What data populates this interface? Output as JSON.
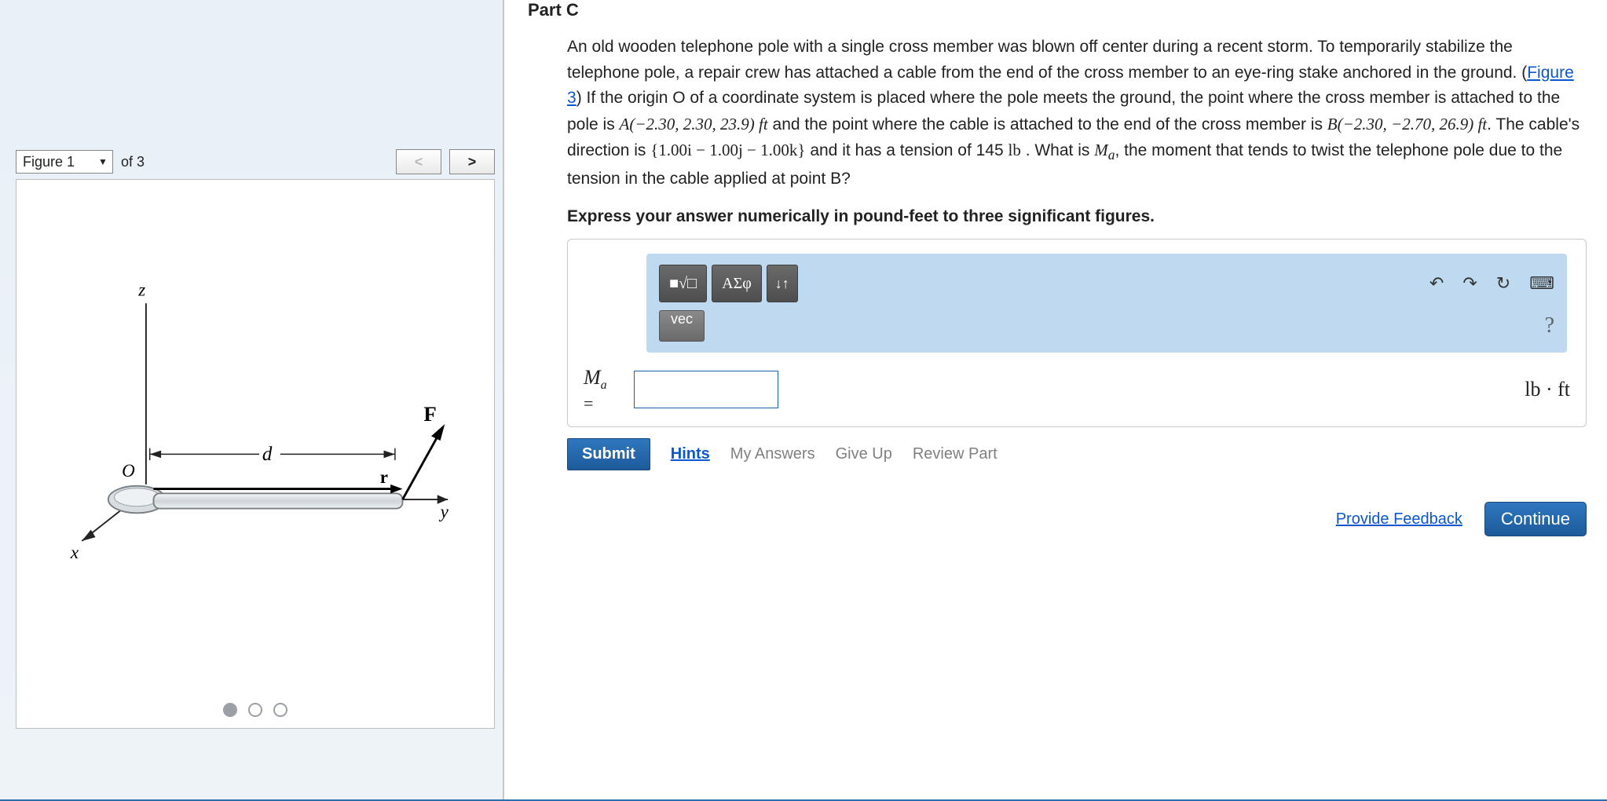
{
  "figure": {
    "selector_label": "Figure 1",
    "of_text": "of 3",
    "prev_label": "<",
    "next_label": ">",
    "active_dot": 1,
    "total_dots": 3,
    "labels": {
      "z": "z",
      "x": "x",
      "y": "y",
      "O": "O",
      "d": "d",
      "r": "r",
      "F": "F"
    }
  },
  "part": {
    "title": "Part C",
    "text_pre": "An old wooden telephone pole with a single cross member was blown off center during a recent storm. To temporarily stabilize the telephone pole, a repair crew has attached a cable from the end of the cross member to an eye-ring stake anchored in the ground. (",
    "figure_link": "Figure 3",
    "text_mid1": ") If the origin O of a coordinate system is placed where the pole meets the ground, the point where the cross member is attached to the pole is ",
    "pointA": "A(−2.30, 2.30, 23.9) ft",
    "text_mid2": " and the point where the cable is attached to the end of the cross member is ",
    "pointB": "B(−2.30, −2.70, 26.9) ft",
    "text_mid3": ". The cable's direction is ",
    "direction": "{1.00i − 1.00j − 1.00k}",
    "text_mid4": " and it has a tension of 145 ",
    "tension_unit": "lb",
    "text_mid5": " . What is ",
    "Ma_sym": "M",
    "Ma_sub": "a",
    "text_end": ", the moment that tends to twist the telephone pole due to the tension in the cable applied at point B?",
    "instruction": "Express your answer numerically in pound-feet to three significant figures."
  },
  "toolbar": {
    "templates": "■√□",
    "greek": "ΑΣφ",
    "updown": "↓↑",
    "undo": "↶",
    "redo": "↷",
    "reset": "↻",
    "keyboard": "⌨",
    "vec": "vec",
    "help": "?"
  },
  "answer": {
    "label_main": "M",
    "label_sub": "a",
    "equals": "=",
    "value": "",
    "unit": "lb · ft"
  },
  "actions": {
    "submit": "Submit",
    "hints": "Hints",
    "my_answers": "My Answers",
    "give_up": "Give Up",
    "review": "Review Part",
    "feedback": "Provide Feedback",
    "continue": "Continue"
  }
}
